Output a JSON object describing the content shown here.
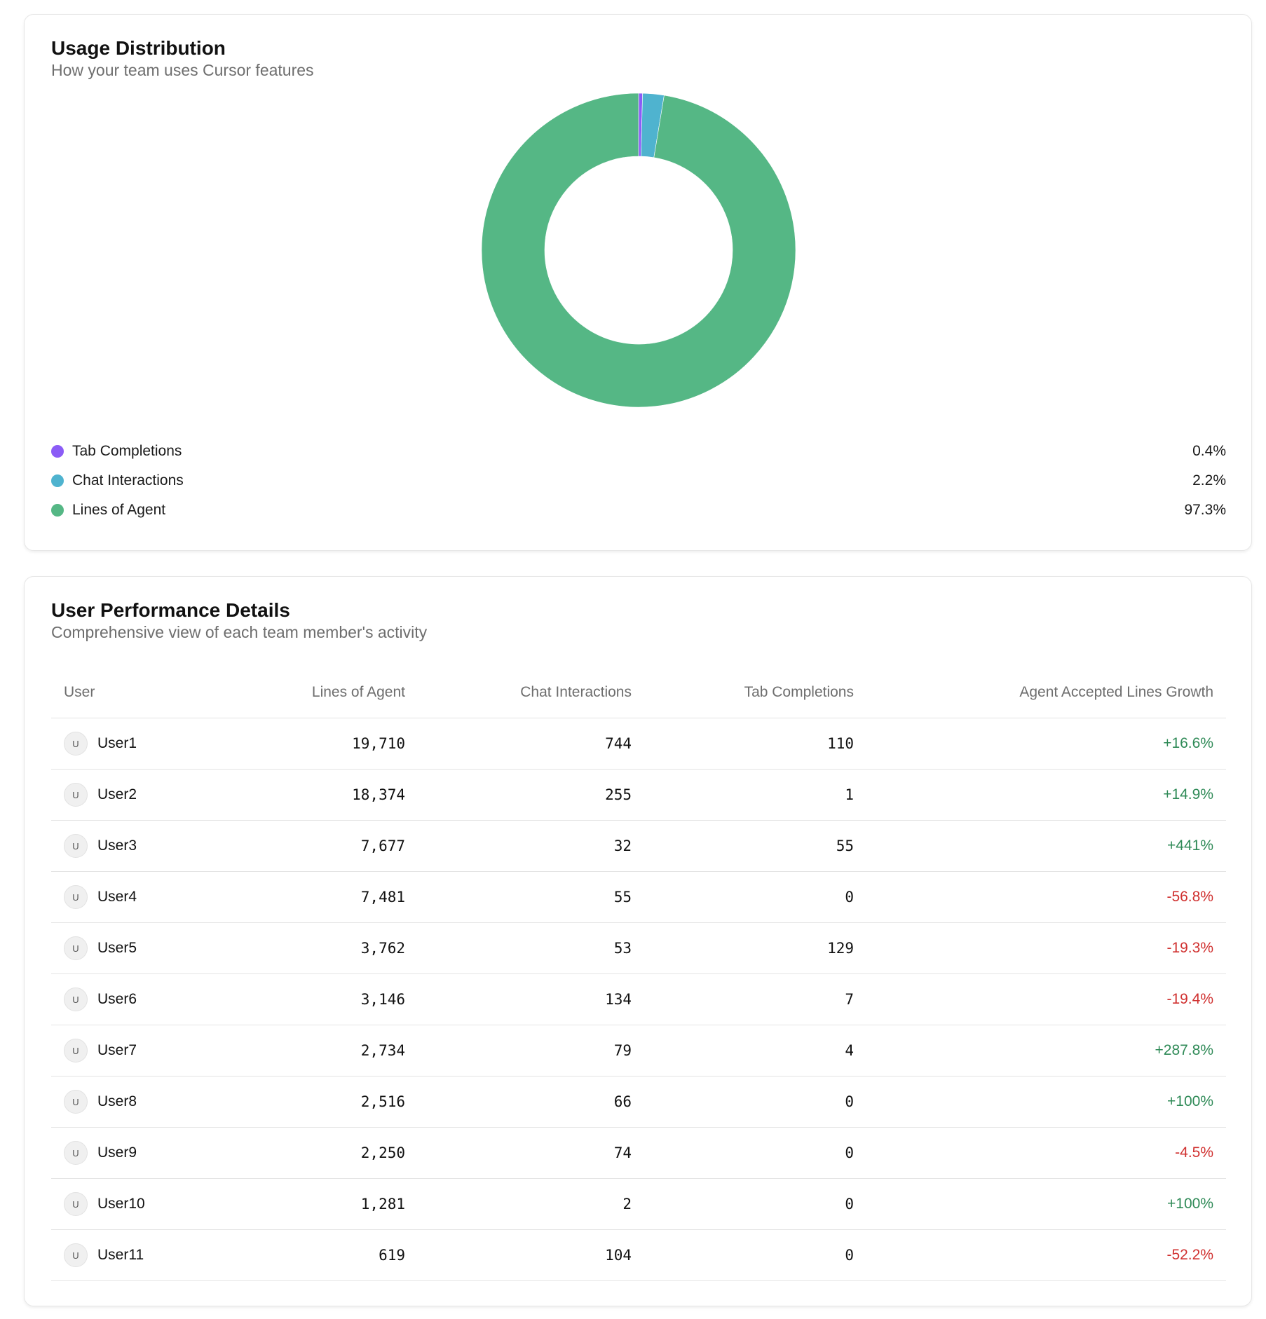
{
  "usage": {
    "title": "Usage Distribution",
    "subtitle": "How your team uses Cursor features",
    "legend": [
      {
        "label": "Tab Completions",
        "value": "0.4%",
        "color": "#8b5cf6"
      },
      {
        "label": "Chat Interactions",
        "value": "2.2%",
        "color": "#4fb3cf"
      },
      {
        "label": "Lines of Agent",
        "value": "97.3%",
        "color": "#55b785"
      }
    ]
  },
  "chart_data": {
    "type": "pie",
    "variant": "donut",
    "title": "Usage Distribution",
    "categories": [
      "Tab Completions",
      "Chat Interactions",
      "Lines of Agent"
    ],
    "values": [
      0.4,
      2.2,
      97.3
    ],
    "colors": [
      "#8b5cf6",
      "#4fb3cf",
      "#55b785"
    ],
    "unit": "%",
    "legend": "bottom"
  },
  "performance": {
    "title": "User Performance Details",
    "subtitle": "Comprehensive view of each team member's activity",
    "columns": {
      "user": "User",
      "lines": "Lines of Agent",
      "chat": "Chat Interactions",
      "tab": "Tab Completions",
      "growth": "Agent Accepted Lines Growth"
    },
    "colors": {
      "positive": "#2f8a57",
      "negative": "#d0302f"
    },
    "rows": [
      {
        "initial": "U",
        "name": "User1",
        "lines": "19,710",
        "chat": "744",
        "tab": "110",
        "growth": "+16.6%"
      },
      {
        "initial": "U",
        "name": "User2",
        "lines": "18,374",
        "chat": "255",
        "tab": "1",
        "growth": "+14.9%"
      },
      {
        "initial": "U",
        "name": "User3",
        "lines": "7,677",
        "chat": "32",
        "tab": "55",
        "growth": "+441%"
      },
      {
        "initial": "U",
        "name": "User4",
        "lines": "7,481",
        "chat": "55",
        "tab": "0",
        "growth": "-56.8%"
      },
      {
        "initial": "U",
        "name": "User5",
        "lines": "3,762",
        "chat": "53",
        "tab": "129",
        "growth": "-19.3%"
      },
      {
        "initial": "U",
        "name": "User6",
        "lines": "3,146",
        "chat": "134",
        "tab": "7",
        "growth": "-19.4%"
      },
      {
        "initial": "U",
        "name": "User7",
        "lines": "2,734",
        "chat": "79",
        "tab": "4",
        "growth": "+287.8%"
      },
      {
        "initial": "U",
        "name": "User8",
        "lines": "2,516",
        "chat": "66",
        "tab": "0",
        "growth": "+100%"
      },
      {
        "initial": "U",
        "name": "User9",
        "lines": "2,250",
        "chat": "74",
        "tab": "0",
        "growth": "-4.5%"
      },
      {
        "initial": "U",
        "name": "User10",
        "lines": "1,281",
        "chat": "2",
        "tab": "0",
        "growth": "+100%"
      },
      {
        "initial": "U",
        "name": "User11",
        "lines": "619",
        "chat": "104",
        "tab": "0",
        "growth": "-52.2%"
      }
    ]
  }
}
